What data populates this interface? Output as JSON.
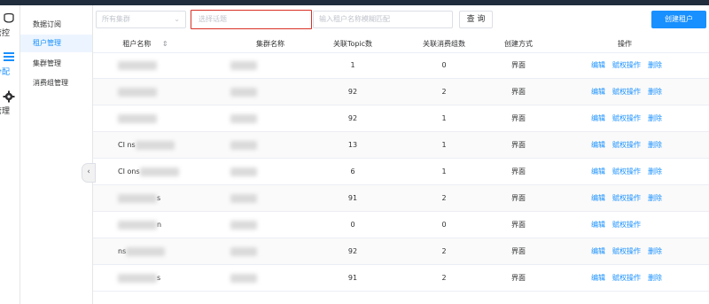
{
  "sidebar_rail": {
    "items": [
      {
        "label": "管控",
        "icon": "pipe-icon"
      },
      {
        "label": "分配",
        "icon": "menu-icon"
      },
      {
        "label": "管理",
        "icon": "gear-icon"
      }
    ]
  },
  "submenu": {
    "items": [
      {
        "label": "数据订阅"
      },
      {
        "label": "租户管理",
        "active": true
      },
      {
        "label": "集群管理"
      },
      {
        "label": "消费组管理"
      }
    ]
  },
  "filters": {
    "cluster_select_placeholder": "所有集群",
    "topic_select_placeholder": "选择话题",
    "tenant_name_placeholder": "输入租户名称模糊匹配",
    "search_label": "查 询",
    "create_label": "创建租户"
  },
  "table": {
    "headers": [
      "租户名称",
      "集群名称",
      "关联Topic数",
      "关联消费组数",
      "创建方式",
      "操作"
    ],
    "action_labels": {
      "edit": "编辑",
      "grant": "赋权操作",
      "delete": "删除"
    },
    "rows": [
      {
        "tenant": "",
        "cluster": "",
        "topics": "1",
        "groups": "0",
        "mode": "界面",
        "has_delete": true
      },
      {
        "tenant": "",
        "cluster": "",
        "topics": "92",
        "groups": "2",
        "mode": "界面",
        "has_delete": true
      },
      {
        "tenant": "",
        "cluster": "",
        "topics": "92",
        "groups": "1",
        "mode": "界面",
        "has_delete": true
      },
      {
        "tenant": "CI ns",
        "cluster": "",
        "topics": "13",
        "groups": "1",
        "mode": "界面",
        "has_delete": true
      },
      {
        "tenant": "CI ons",
        "cluster": "",
        "topics": "6",
        "groups": "1",
        "mode": "界面",
        "has_delete": true
      },
      {
        "tenant": "s",
        "cluster": "",
        "topics": "91",
        "groups": "2",
        "mode": "界面",
        "has_delete": true
      },
      {
        "tenant": "n",
        "cluster": "",
        "topics": "0",
        "groups": "0",
        "mode": "界面",
        "has_delete": false
      },
      {
        "tenant": "ns",
        "cluster": "",
        "topics": "92",
        "groups": "2",
        "mode": "界面",
        "has_delete": true
      },
      {
        "tenant": "s",
        "cluster": "",
        "topics": "91",
        "groups": "2",
        "mode": "界面",
        "has_delete": true
      }
    ]
  },
  "colors": {
    "accent": "#1890ff",
    "highlight_border": "#d93025"
  }
}
